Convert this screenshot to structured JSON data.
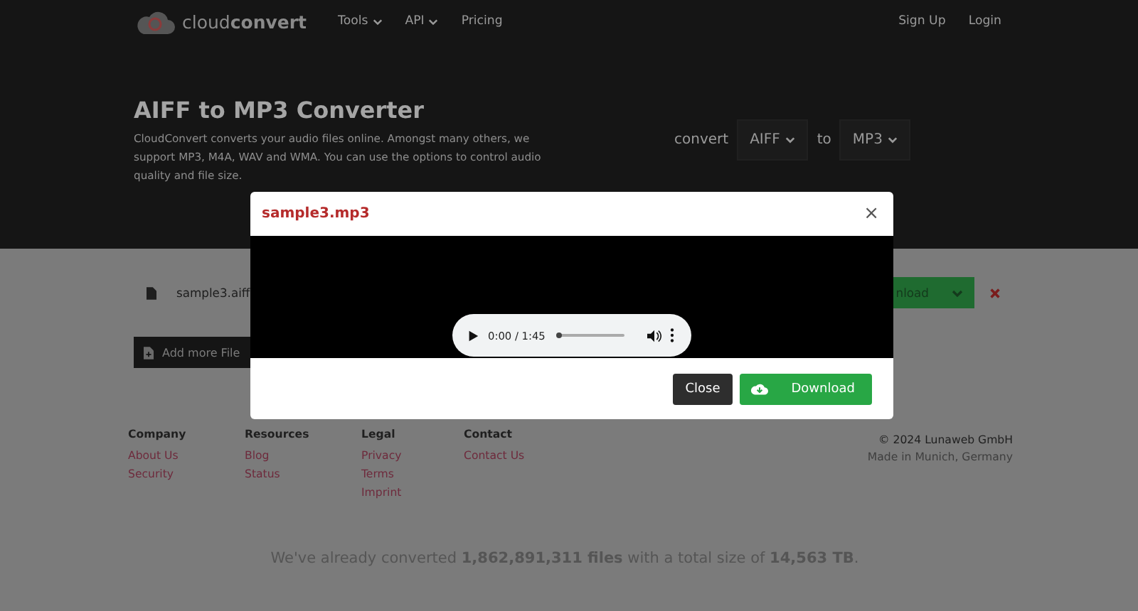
{
  "nav": {
    "logo": "cloud**convert**",
    "menu": [
      {
        "label": "Tools",
        "dropdown": true
      },
      {
        "label": "API",
        "dropdown": true
      },
      {
        "label": "Pricing",
        "dropdown": false
      }
    ],
    "auth": [
      "Sign Up",
      "Login"
    ]
  },
  "hero": {
    "title": "AIFF to MP3 Converter",
    "description": "CloudConvert converts your audio files online. Amongst many others, we support MP3, M4A, WAV and WMA. You can use the options to control audio quality and file size.",
    "convert_label": "convert",
    "from": "AIFF",
    "to_label": "to",
    "to": "MP3"
  },
  "file": {
    "name": "sample3.aiff",
    "download_button": "nload"
  },
  "add_button": "Add more File",
  "footer": {
    "columns": [
      {
        "heading": "Company",
        "links": [
          "About Us",
          "Security"
        ]
      },
      {
        "heading": "Resources",
        "links": [
          "Blog",
          "Status"
        ]
      },
      {
        "heading": "Legal",
        "links": [
          "Privacy",
          "Terms",
          "Imprint"
        ]
      },
      {
        "heading": "Contact",
        "links": [
          "Contact Us"
        ]
      }
    ],
    "copyright": "© 2024 Lunaweb GmbH",
    "location": "Made in Munich, Germany",
    "stats": "We've already converted **1,862,891,311 files** with a total size of **14,563 TB**."
  },
  "modal": {
    "title": "sample3.mp3",
    "close": "×",
    "player": {
      "time": "0:00 / 1:45",
      "level": 0
    },
    "buttons": [
      {
        "label": "Close",
        "kind": "secondary"
      },
      {
        "label": "Download",
        "kind": "primary"
      }
    ]
  }
}
